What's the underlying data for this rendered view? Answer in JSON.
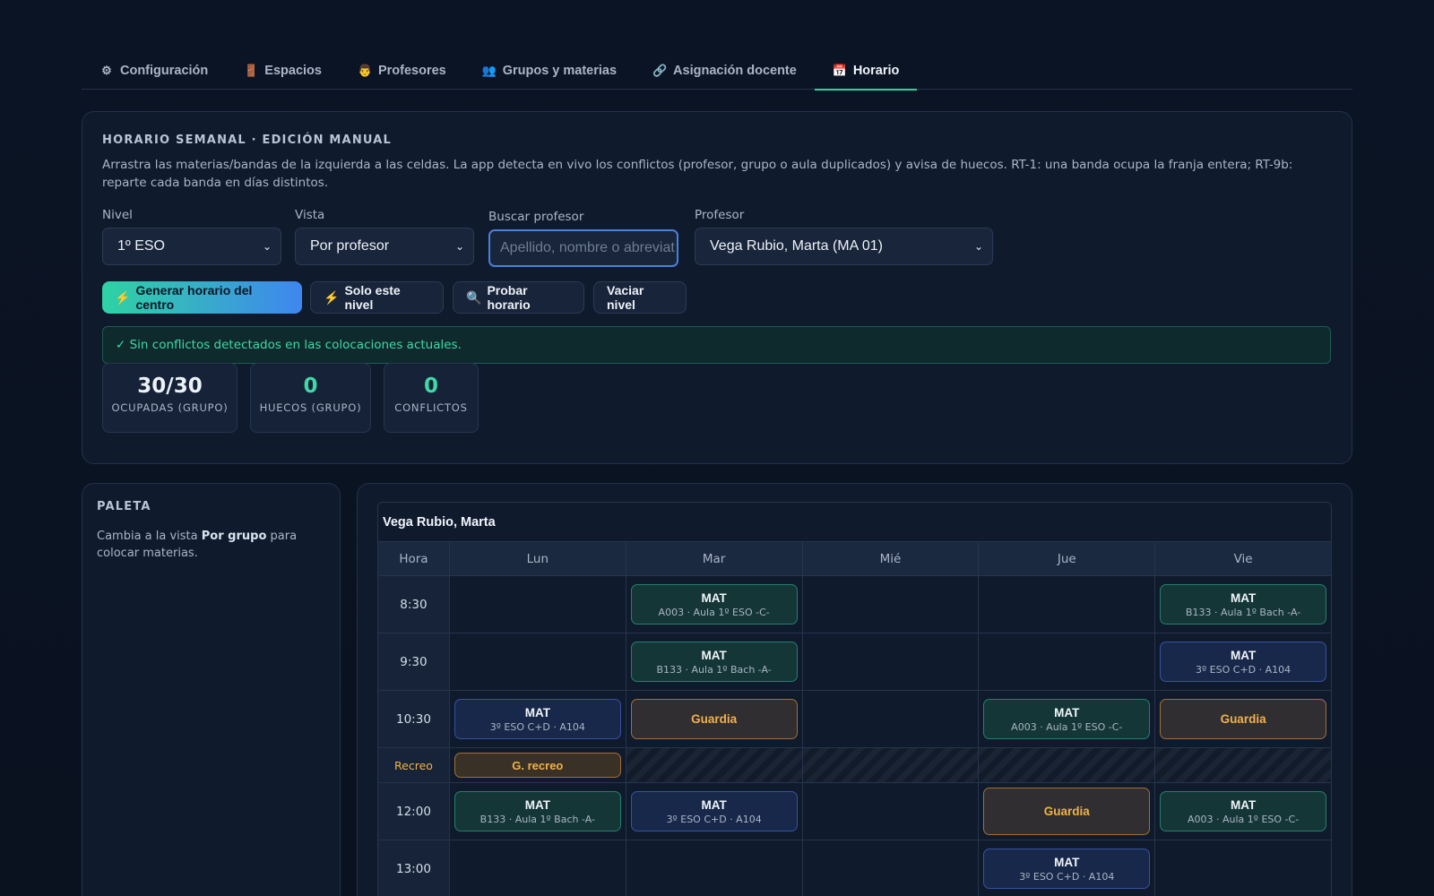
{
  "tabs": [
    {
      "icon": "⚙",
      "label": "Configuración",
      "active": false
    },
    {
      "icon": "🚪",
      "label": "Espacios",
      "active": false
    },
    {
      "icon": "👨",
      "label": "Profesores",
      "active": false
    },
    {
      "icon": "👥",
      "label": "Grupos y materias",
      "active": false
    },
    {
      "icon": "🔗",
      "label": "Asignación docente",
      "active": false
    },
    {
      "icon": "📅",
      "label": "Horario",
      "active": true
    }
  ],
  "panel": {
    "title": "Horario semanal · edición manual",
    "description": "Arrastra las materias/bandas de la izquierda a las celdas. La app detecta en vivo los conflictos (profesor, grupo o aula duplicados) y avisa de huecos. RT-1: una banda ocupa la franja entera; RT-9b: reparte cada banda en días distintos.",
    "nivel": {
      "label": "Nivel",
      "value": "1º ESO"
    },
    "vista": {
      "label": "Vista",
      "value": "Por profesor"
    },
    "buscar": {
      "label": "Buscar profesor",
      "placeholder": "Apellido, nombre o abreviat"
    },
    "profesor": {
      "label": "Profesor",
      "value": "Vega Rubio, Marta (MA 01)"
    },
    "buttons": {
      "generar": "Generar horario del centro",
      "solo_nivel": "Solo este nivel",
      "probar": "Probar horario",
      "vaciar": "Vaciar nivel"
    },
    "status": "✓ Sin conflictos detectados en las colocaciones actuales.",
    "stats": [
      {
        "value": "30/30",
        "label": "Ocupadas (grupo)"
      },
      {
        "value": "0",
        "label": "Huecos (grupo)"
      },
      {
        "value": "0",
        "label": "Conflictos"
      }
    ]
  },
  "palette": {
    "title": "Paleta",
    "text_before": "Cambia a la vista ",
    "text_bold": "Por grupo",
    "text_after": " para colocar materias."
  },
  "timetable": {
    "teacher": "Vega Rubio, Marta",
    "hour_header": "Hora",
    "days": [
      "Lun",
      "Mar",
      "Mié",
      "Jue",
      "Vie"
    ],
    "rows": [
      {
        "hour": "8:30",
        "cells": [
          null,
          {
            "kind": "green",
            "title": "MAT",
            "sub": "A003 · Aula 1º ESO -C-"
          },
          null,
          null,
          {
            "kind": "green",
            "title": "MAT",
            "sub": "B133 · Aula 1º Bach -A-"
          }
        ]
      },
      {
        "hour": "9:30",
        "cells": [
          null,
          {
            "kind": "green",
            "title": "MAT",
            "sub": "B133 · Aula 1º Bach -A-"
          },
          null,
          null,
          {
            "kind": "blue",
            "title": "MAT",
            "sub": "3º ESO C+D · A104"
          }
        ]
      },
      {
        "hour": "10:30",
        "cells": [
          {
            "kind": "blue",
            "title": "MAT",
            "sub": "3º ESO C+D · A104"
          },
          {
            "kind": "orange",
            "title": "Guardia",
            "sub": ""
          },
          null,
          {
            "kind": "green",
            "title": "MAT",
            "sub": "A003 · Aula 1º ESO -C-"
          },
          {
            "kind": "orange",
            "title": "Guardia",
            "sub": ""
          }
        ]
      },
      {
        "hour": "Recreo",
        "break": true,
        "cells": [
          {
            "kind": "small",
            "title": "G. recreo",
            "sub": ""
          },
          null,
          null,
          null,
          null
        ]
      },
      {
        "hour": "12:00",
        "cells": [
          {
            "kind": "green",
            "title": "MAT",
            "sub": "B133 · Aula 1º Bach -A-"
          },
          {
            "kind": "blue",
            "title": "MAT",
            "sub": "3º ESO C+D · A104"
          },
          null,
          {
            "kind": "orange",
            "title": "Guardia",
            "sub": "",
            "tall": true
          },
          {
            "kind": "green",
            "title": "MAT",
            "sub": "A003 · Aula 1º ESO -C-"
          }
        ]
      },
      {
        "hour": "13:00",
        "cells": [
          null,
          null,
          null,
          {
            "kind": "blue",
            "title": "MAT",
            "sub": "3º ESO C+D · A104"
          },
          null
        ]
      }
    ]
  }
}
